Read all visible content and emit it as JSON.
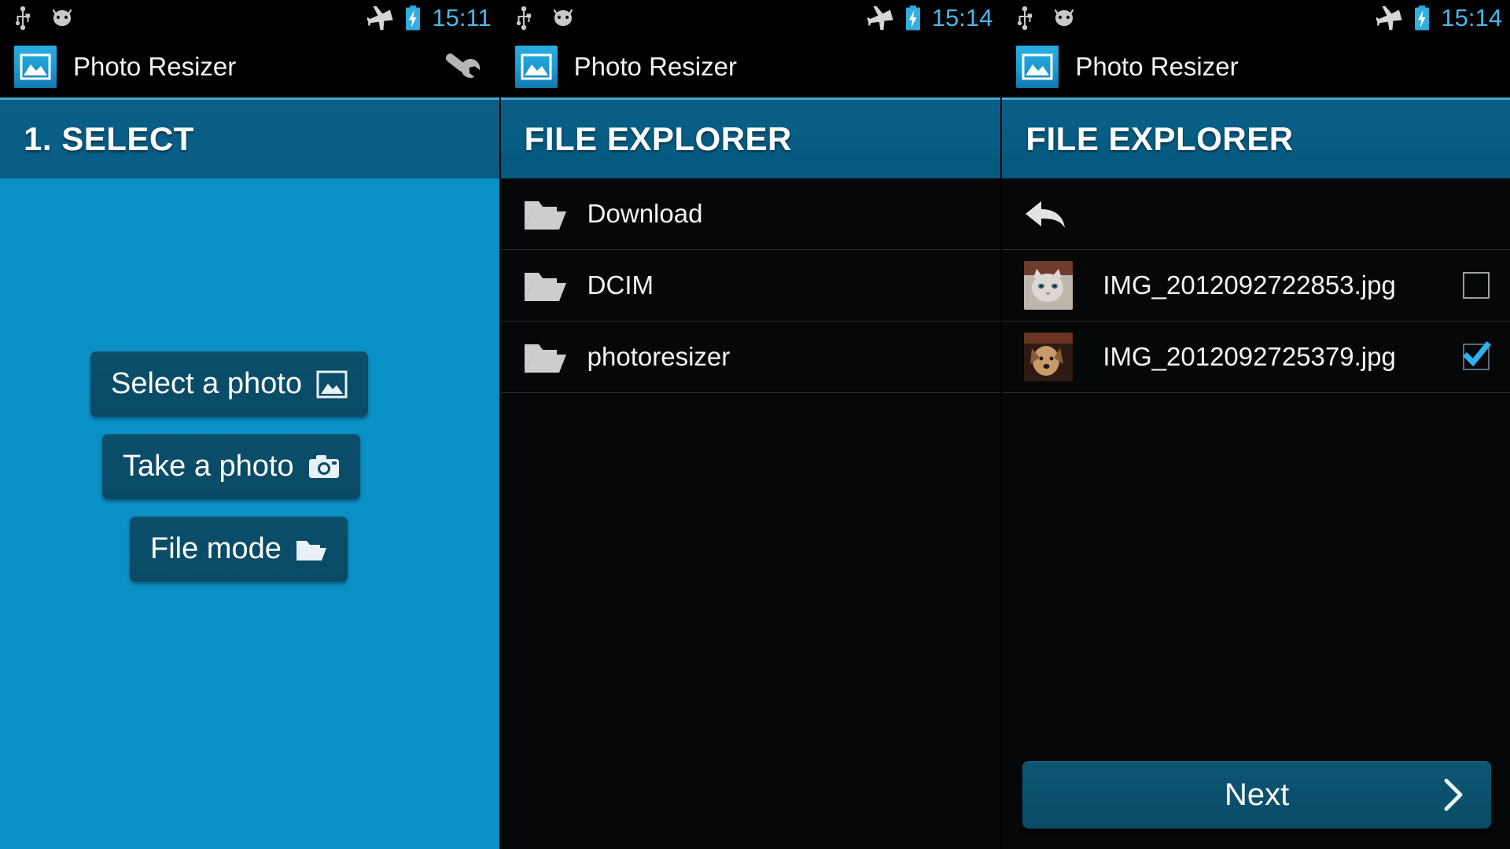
{
  "panels": [
    {
      "id": "panel-select",
      "statusbar": {
        "time": "15:11",
        "left_icons": [
          "usb-icon",
          "android-icon"
        ],
        "right_icons": [
          "airplane-mode-icon",
          "battery-charging-icon"
        ]
      },
      "actionbar": {
        "app_title": "Photo Resizer",
        "logo": "photo-resizer-logo",
        "overflow_icon": "wrench-icon"
      },
      "header": {
        "title": "1. SELECT"
      },
      "buttons": [
        {
          "label": "Select a photo",
          "icon": "picture-icon"
        },
        {
          "label": "Take a photo",
          "icon": "camera-icon"
        },
        {
          "label": "File mode",
          "icon": "folder-open-icon"
        }
      ]
    },
    {
      "id": "panel-explorer-folders",
      "statusbar": {
        "time": "15:14",
        "left_icons": [
          "usb-icon",
          "android-icon"
        ],
        "right_icons": [
          "airplane-mode-icon",
          "battery-charging-icon"
        ]
      },
      "actionbar": {
        "app_title": "Photo Resizer",
        "logo": "photo-resizer-logo"
      },
      "header": {
        "title": "FILE EXPLORER"
      },
      "rows": [
        {
          "name": "Download",
          "icon": "folder-icon"
        },
        {
          "name": "DCIM",
          "icon": "folder-icon"
        },
        {
          "name": "photoresizer",
          "icon": "folder-icon"
        }
      ]
    },
    {
      "id": "panel-explorer-files",
      "statusbar": {
        "time": "15:14",
        "left_icons": [
          "usb-icon",
          "android-icon"
        ],
        "right_icons": [
          "airplane-mode-icon",
          "battery-charging-icon"
        ]
      },
      "actionbar": {
        "app_title": "Photo Resizer",
        "logo": "photo-resizer-logo"
      },
      "header": {
        "title": "FILE EXPLORER"
      },
      "up_row": {
        "icon": "back-arrow-icon"
      },
      "rows": [
        {
          "name": "IMG_2012092722853.jpg",
          "thumbnail": "cat-thumbnail",
          "checked": false
        },
        {
          "name": "IMG_2012092725379.jpg",
          "thumbnail": "dog-thumbnail",
          "checked": true
        }
      ],
      "next_button": {
        "label": "Next",
        "icon": "chevron-right-icon"
      }
    }
  ],
  "colors": {
    "accent_blue": "#0b90c6",
    "header_teal": "#075d84",
    "header_top_line": "#43a8d4",
    "time_blue": "#49b6e8",
    "button_fill": "#0a4a64",
    "checkbox_checked": "#29b6f0",
    "list_bg": "#050708"
  }
}
